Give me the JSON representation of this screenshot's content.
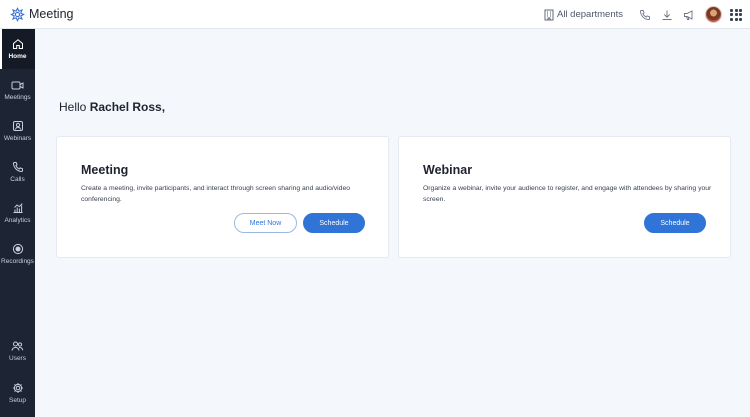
{
  "header": {
    "app_name": "Meeting",
    "department_label": "All departments",
    "icons": [
      "meeting-logo-icon",
      "building-icon",
      "phone-icon",
      "download-icon",
      "megaphone-icon",
      "apps-grid-icon"
    ]
  },
  "sidebar": {
    "items": [
      {
        "label": "Home",
        "icon": "home-icon",
        "active": true
      },
      {
        "label": "Meetings",
        "icon": "video-icon"
      },
      {
        "label": "Webinars",
        "icon": "webinar-icon"
      },
      {
        "label": "Calls",
        "icon": "phone-icon"
      },
      {
        "label": "Analytics",
        "icon": "analytics-icon"
      },
      {
        "label": "Recordings",
        "icon": "record-icon"
      },
      {
        "label": "Users",
        "icon": "users-icon"
      },
      {
        "label": "Setup",
        "icon": "gear-icon"
      }
    ]
  },
  "greeting": {
    "prefix": "Hello",
    "name": "Rachel Ross,"
  },
  "cards": {
    "meeting": {
      "title": "Meeting",
      "description": "Create a meeting, invite participants, and interact through screen sharing and audio/video conferencing.",
      "secondary_button": "Meet Now",
      "primary_button": "Schedule"
    },
    "webinar": {
      "title": "Webinar",
      "description": "Organize a webinar, invite your audience to register, and engage with attendees by sharing your screen.",
      "primary_button": "Schedule"
    }
  },
  "colors": {
    "sidebar": "#1d2433",
    "accent": "#2f74d6",
    "background": "#f4f7fb"
  }
}
